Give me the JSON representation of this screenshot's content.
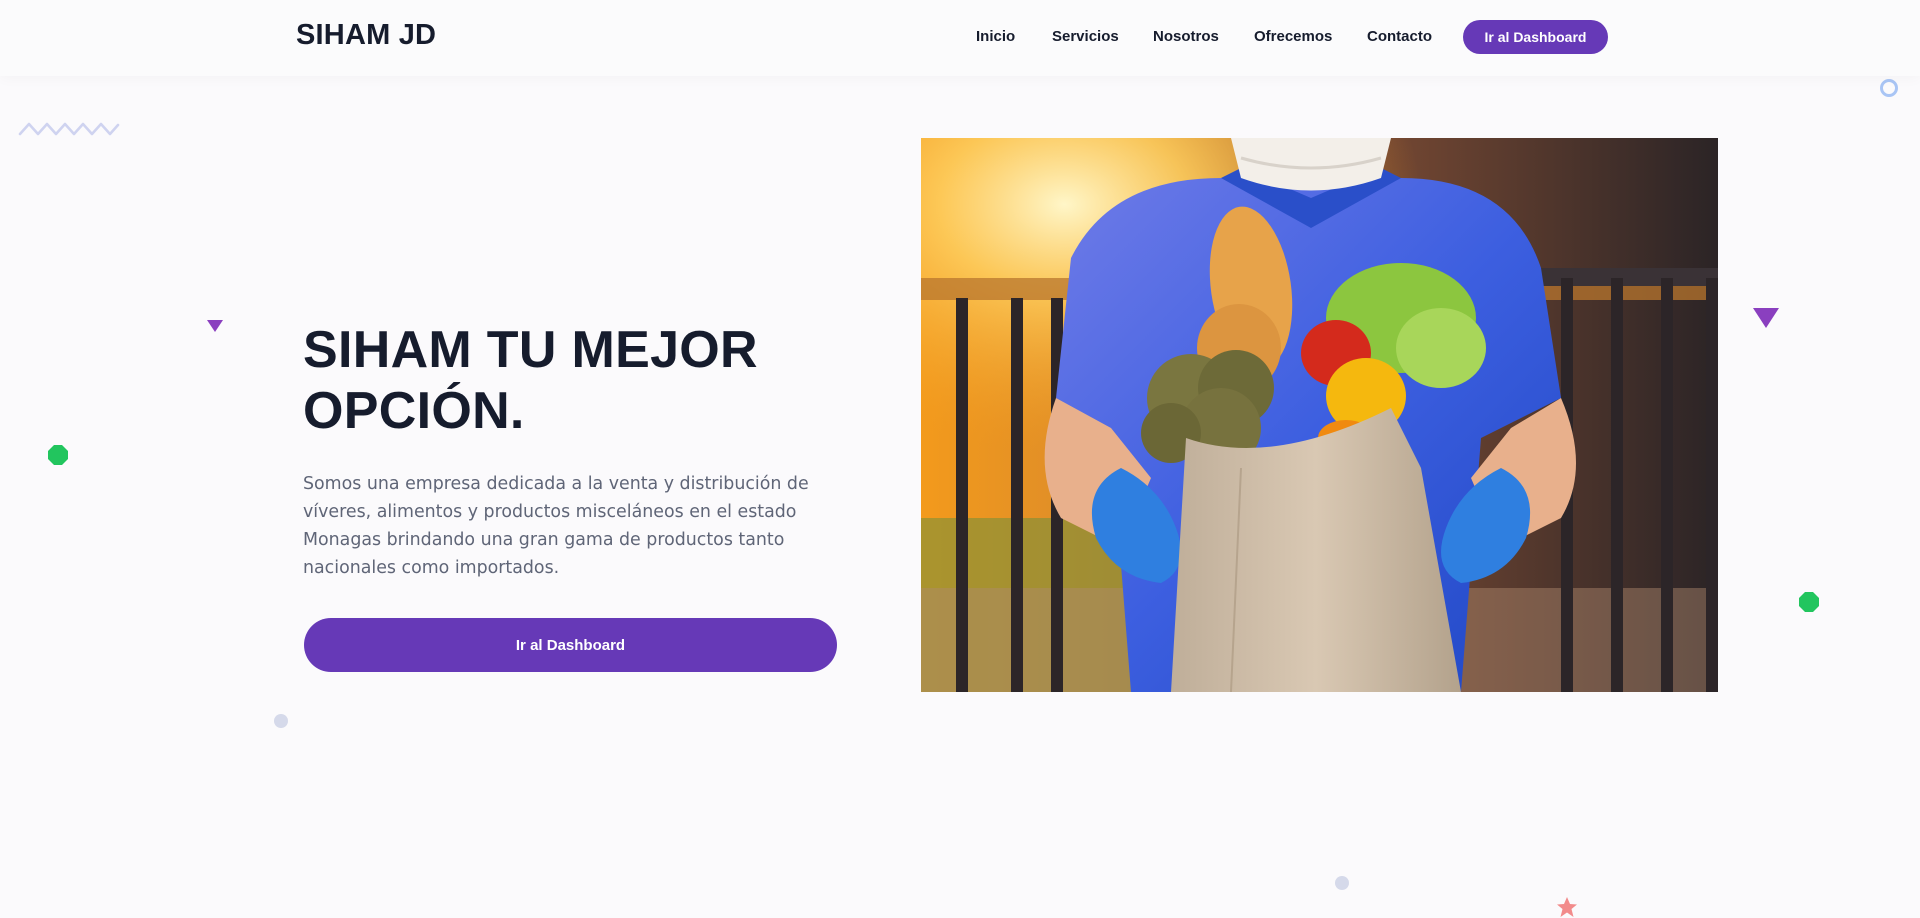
{
  "brand": {
    "name": "SIHAM JD"
  },
  "nav": {
    "links": [
      "Inicio",
      "Servicios",
      "Nosotros",
      "Ofrecemos",
      "Contacto"
    ],
    "cta_label": "Ir al Dashboard"
  },
  "hero": {
    "title": "SIHAM TU MEJOR OPCIÓN.",
    "description": "Somos una empresa dedicada a la venta y distribución de víveres, alimentos y productos misceláneos en el estado Monagas brindando una gran gama de productos tanto nacionales como importados.",
    "cta_label": "Ir al Dashboard",
    "image_icon": "delivery-person-grocery-bag-photo"
  },
  "colors": {
    "primary": "#6639b7",
    "heading": "#161c2d",
    "body_text": "#5f6577",
    "background": "#fbfafc",
    "deco_purple": "#8a3fbf",
    "deco_green": "#22c55e",
    "deco_lilac": "#d5d9ea",
    "deco_coral": "#f28b8b"
  },
  "decorations": [
    "zigzag-icon",
    "ring-icon",
    "triangle-icon",
    "octagon-icon",
    "dot-icon",
    "star-icon"
  ]
}
